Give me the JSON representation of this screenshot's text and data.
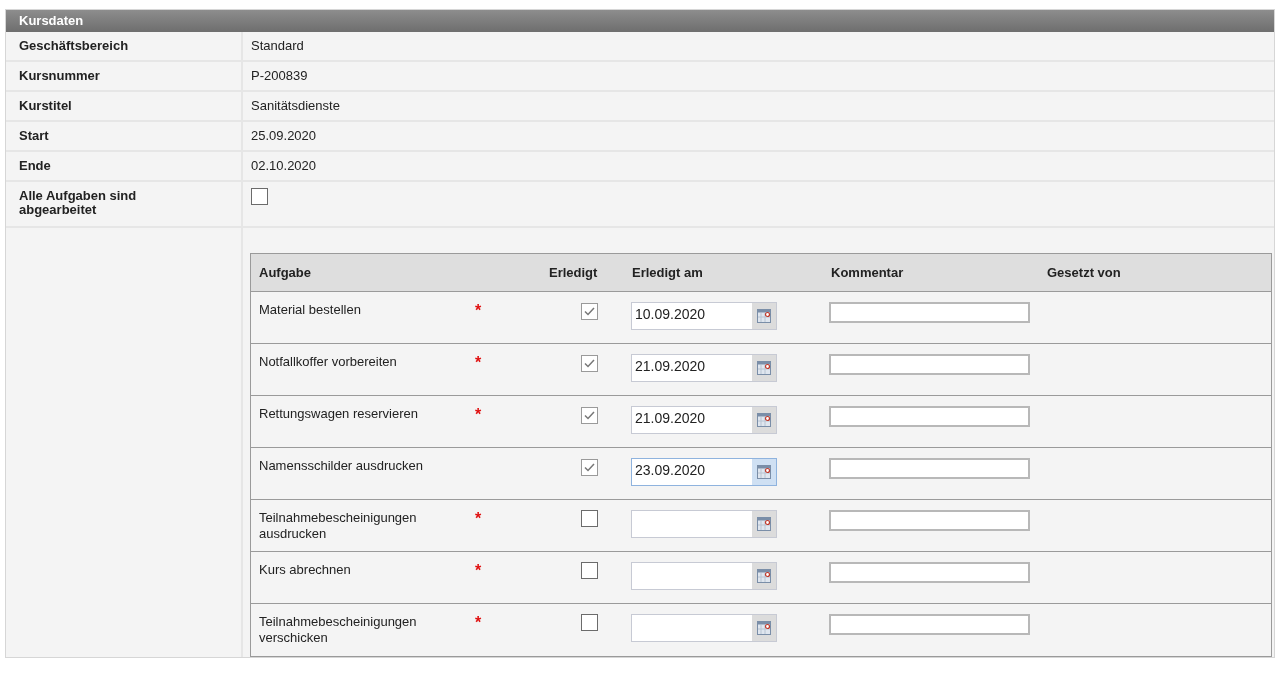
{
  "panel": {
    "title": "Kursdaten"
  },
  "fields": [
    {
      "label": "Geschäftsbereich",
      "value": "Standard"
    },
    {
      "label": "Kursnummer",
      "value": "P-200839"
    },
    {
      "label": "Kurstitel",
      "value": "Sanitätsdienste"
    },
    {
      "label": "Start",
      "value": "25.09.2020"
    },
    {
      "label": "Ende",
      "value": "02.10.2020"
    }
  ],
  "all_done": {
    "label": "Alle Aufgaben sind abgearbeitet",
    "checked": false
  },
  "tasks": {
    "columns": [
      "Aufgabe",
      "Erledigt",
      "Erledigt am",
      "Kommentar",
      "Gesetzt von"
    ],
    "rows": [
      {
        "task": "Material bestellen",
        "required_mark": "*",
        "done": true,
        "date": "10.09.2020",
        "focused": false
      },
      {
        "task": "Notfallkoffer vorbereiten",
        "required_mark": "*",
        "done": true,
        "date": "21.09.2020",
        "focused": false
      },
      {
        "task": "Rettungswagen reservieren",
        "required_mark": "*",
        "done": true,
        "date": "21.09.2020",
        "focused": false
      },
      {
        "task": "Namensschilder ausdrucken",
        "done": true,
        "date": "23.09.2020",
        "focused": true
      },
      {
        "task": "Teilnahmebescheinigungen ausdrucken",
        "required_mark": "*",
        "done": false,
        "focused": false
      },
      {
        "task": "Kurs abrechnen",
        "required_mark": "*",
        "done": false,
        "focused": false
      },
      {
        "task": "Teilnahmebescheinigungen verschicken",
        "required_mark": "*",
        "done": false,
        "focused": false
      }
    ]
  }
}
